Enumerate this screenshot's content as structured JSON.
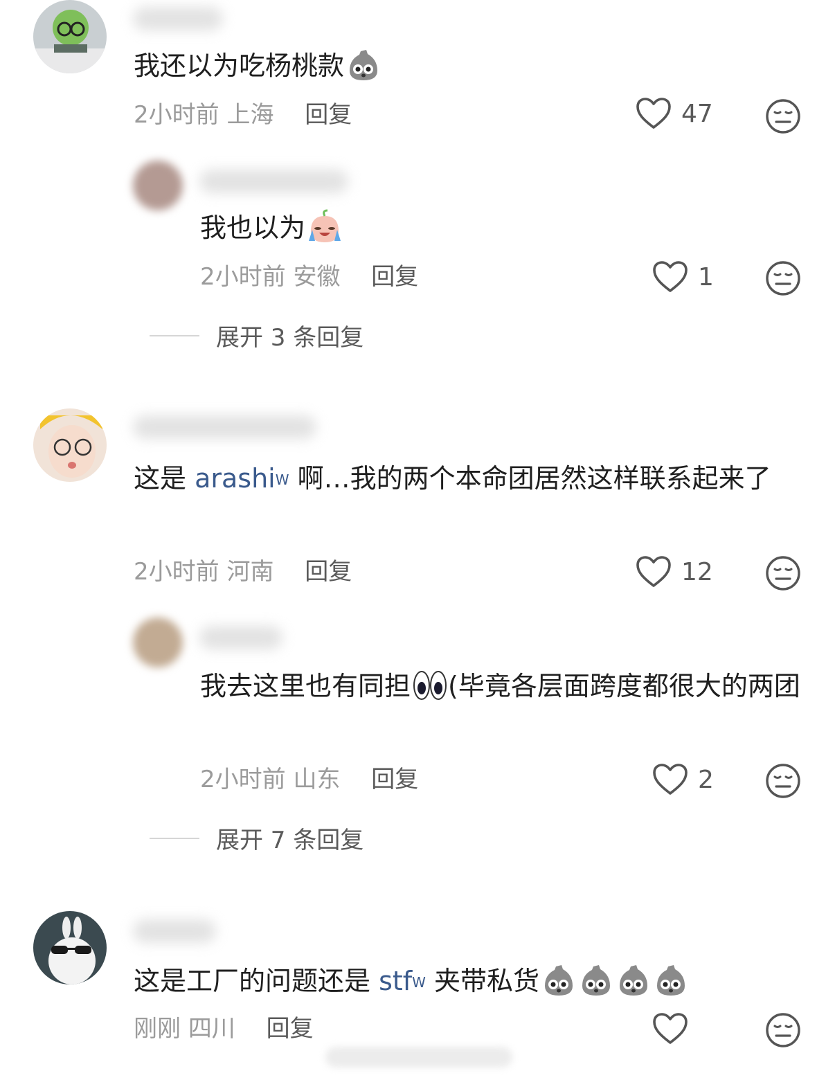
{
  "comments": [
    {
      "text": "我还以为吃杨桃款",
      "emoji_count": 1,
      "time": "2小时前",
      "location": "上海",
      "reply_label": "回复",
      "likes": "47",
      "replies": [
        {
          "text": "我也以为",
          "time": "2小时前",
          "location": "安徽",
          "reply_label": "回复",
          "likes": "1"
        }
      ],
      "expand_label": "展开 3 条回复"
    },
    {
      "text_before": "这是 ",
      "link": "arashi",
      "link_icon": "search-icon",
      "text_after": " 啊…我的两个本命团居然这样联系起来了",
      "time": "2小时前",
      "location": "河南",
      "reply_label": "回复",
      "likes": "12",
      "replies": [
        {
          "text_before": "我去这里也有同担",
          "text_after": "(毕竟各层面跨度都很大的两团",
          "time": "2小时前",
          "location": "山东",
          "reply_label": "回复",
          "likes": "2"
        }
      ],
      "expand_label": "展开 7 条回复"
    },
    {
      "text_before": "这是工厂的问题还是 ",
      "link": "stf",
      "link_icon": "search-icon",
      "text_after": " 夹带私货",
      "emoji_count": 4,
      "time": "刚刚",
      "location": "四川",
      "reply_label": "回复",
      "likes": ""
    }
  ],
  "colors": {
    "link": "#3a5a8c",
    "meta": "#9b9b9b",
    "reply": "#5a5a5a"
  },
  "icons": [
    "heart-outline-icon",
    "meh-face-icon",
    "sack-face-emoji",
    "crying-face-emoji",
    "eyes-emoji",
    "search-icon"
  ]
}
